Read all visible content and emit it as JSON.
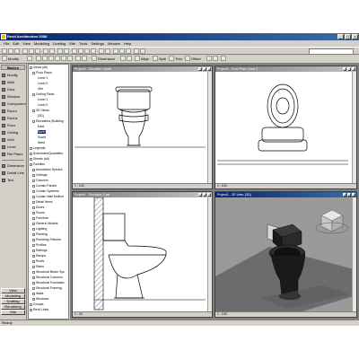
{
  "window": {
    "title": "Revit Architecture 2008"
  },
  "menu": [
    "File",
    "Edit",
    "View",
    "Modelling",
    "Drafting",
    "Site",
    "Tools",
    "Settings",
    "Window",
    "Help"
  ],
  "toolbar2": {
    "modify": "Modify",
    "select": "—",
    "dimension": "Dimension",
    "align": "Align",
    "split": "Split",
    "trim": "Trim",
    "offset": "Offset"
  },
  "left_panel": {
    "header": "Basics",
    "items": [
      "Modify",
      "Wall",
      "Door",
      "Window",
      "Component",
      "Room",
      "Roof ▸",
      "Floor",
      "Ceiling",
      "Grid",
      "Level",
      "Ref Plane"
    ],
    "section_items": [
      "Dimension",
      "Detail Line",
      "Text"
    ],
    "tabs": [
      "View",
      "Modelling",
      "Drafting",
      "Rendering",
      "Site"
    ]
  },
  "project_browser": {
    "items": [
      {
        "text": "Views (all)",
        "level": 0,
        "sel": false
      },
      {
        "text": "Floor Plans",
        "level": 1,
        "sel": false
      },
      {
        "text": "Level 1",
        "level": 3,
        "sel": false
      },
      {
        "text": "Level 2",
        "level": 3,
        "sel": false
      },
      {
        "text": "Site",
        "level": 3,
        "sel": false
      },
      {
        "text": "Ceiling Plans",
        "level": 1,
        "sel": false
      },
      {
        "text": "Level 1",
        "level": 3,
        "sel": false
      },
      {
        "text": "Level 2",
        "level": 3,
        "sel": false
      },
      {
        "text": "3D Views",
        "level": 1,
        "sel": false
      },
      {
        "text": "{3D}",
        "level": 3,
        "sel": false
      },
      {
        "text": "Elevations (Building",
        "level": 1,
        "sel": false
      },
      {
        "text": "East",
        "level": 3,
        "sel": false
      },
      {
        "text": "North",
        "level": 3,
        "sel": true
      },
      {
        "text": "South",
        "level": 3,
        "sel": false
      },
      {
        "text": "West",
        "level": 3,
        "sel": false
      },
      {
        "text": "Legends",
        "level": 0,
        "sel": false
      },
      {
        "text": "Schedules/Quantities",
        "level": 0,
        "sel": false
      },
      {
        "text": "Sheets (all)",
        "level": 0,
        "sel": false
      },
      {
        "text": "Families",
        "level": 0,
        "sel": false
      },
      {
        "text": "Annotation Symbol",
        "level": 1,
        "sel": false
      },
      {
        "text": "Ceilings",
        "level": 1,
        "sel": false
      },
      {
        "text": "Columns",
        "level": 1,
        "sel": false
      },
      {
        "text": "Curtain Panels",
        "level": 1,
        "sel": false
      },
      {
        "text": "Curtain Systems",
        "level": 1,
        "sel": false
      },
      {
        "text": "Curtain Wall Mullion",
        "level": 1,
        "sel": false
      },
      {
        "text": "Detail Items",
        "level": 1,
        "sel": false
      },
      {
        "text": "Doors",
        "level": 1,
        "sel": false
      },
      {
        "text": "Floors",
        "level": 1,
        "sel": false
      },
      {
        "text": "Furniture",
        "level": 1,
        "sel": false
      },
      {
        "text": "Generic Models",
        "level": 1,
        "sel": false
      },
      {
        "text": "Lighting",
        "level": 1,
        "sel": false
      },
      {
        "text": "Planting",
        "level": 1,
        "sel": false
      },
      {
        "text": "Plumbing Fixtures",
        "level": 1,
        "sel": false
      },
      {
        "text": "Profiles",
        "level": 1,
        "sel": false
      },
      {
        "text": "Railings",
        "level": 1,
        "sel": false
      },
      {
        "text": "Ramps",
        "level": 1,
        "sel": false
      },
      {
        "text": "Roofs",
        "level": 1,
        "sel": false
      },
      {
        "text": "Stairs",
        "level": 1,
        "sel": false
      },
      {
        "text": "Structural Beam Sys",
        "level": 1,
        "sel": false
      },
      {
        "text": "Structural Columns",
        "level": 1,
        "sel": false
      },
      {
        "text": "Structural Foundatio",
        "level": 1,
        "sel": false
      },
      {
        "text": "Structural Framing",
        "level": 1,
        "sel": false
      },
      {
        "text": "Walls",
        "level": 1,
        "sel": false
      },
      {
        "text": "Windows",
        "level": 1,
        "sel": false
      },
      {
        "text": "Groups",
        "level": 0,
        "sel": false
      },
      {
        "text": "Revit Links",
        "level": 0,
        "sel": false
      }
    ]
  },
  "views": {
    "top_left": {
      "title": "Project1 - Elevation: North",
      "scale": "1 : 100"
    },
    "top_right": {
      "title": "Project1 - Floor Plan: Level 1",
      "scale": "1 : 100"
    },
    "bottom_left": {
      "title": "Project1 - Elevation: East",
      "scale": "1 : 20"
    },
    "bottom_right": {
      "title": "Project1 - 3D View: {3D}",
      "scale": "1 : 100"
    }
  },
  "status": {
    "text": "Ready"
  }
}
